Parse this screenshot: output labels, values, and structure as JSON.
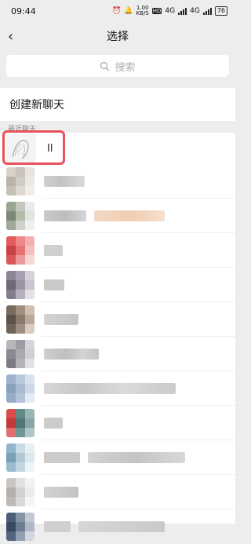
{
  "status_bar": {
    "time": "09:44",
    "net_rate": "1.00",
    "net_unit": "KB/S",
    "hd": "HD",
    "sig1": "4G",
    "sig2": "4G",
    "battery": "76"
  },
  "nav": {
    "back_icon": "back-arrow-icon",
    "title": "选择"
  },
  "search": {
    "placeholder": "搜索",
    "icon": "search-icon"
  },
  "create_chat": {
    "label": "创建新聊天"
  },
  "recent": {
    "label": "最近聊天"
  },
  "first_contact": {
    "name": "Il"
  },
  "highlight_color": "#e8525a"
}
